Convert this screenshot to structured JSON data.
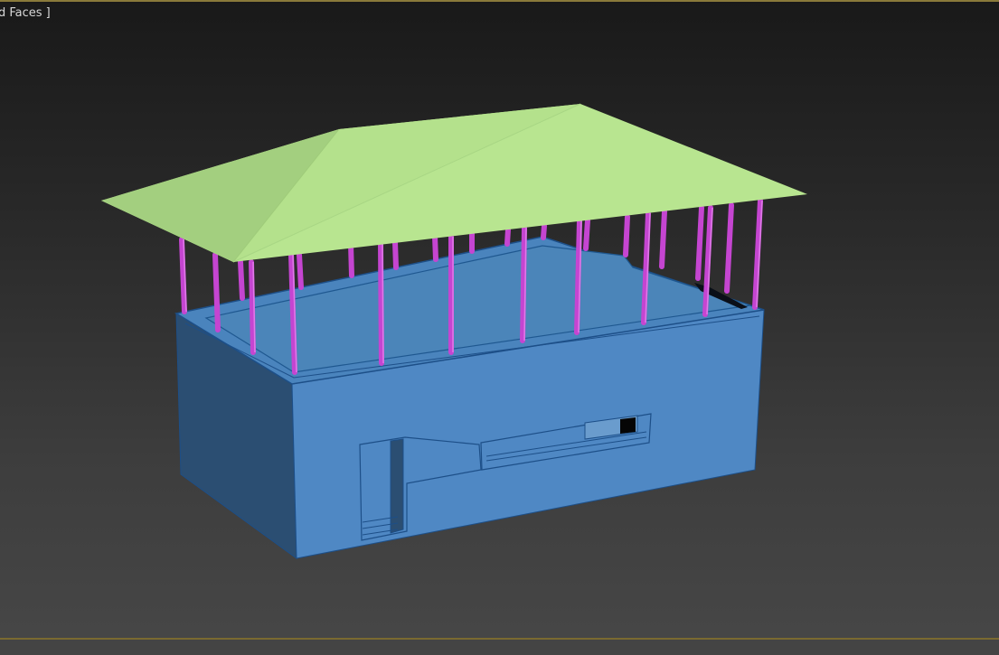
{
  "viewport": {
    "label": "d Faces ]"
  },
  "scene": {
    "objects": [
      "building-body",
      "roof",
      "columns",
      "window",
      "door"
    ],
    "colors": {
      "roof": "#b8e590",
      "roof_shade": "#a3cf7f",
      "wall": "#4f88c4",
      "wall_dark": "#2b4e72",
      "slab": "#4a84bd",
      "column": "#c545d1",
      "edge": "#1d4f88",
      "frame_border": "#8a7a3a"
    }
  }
}
